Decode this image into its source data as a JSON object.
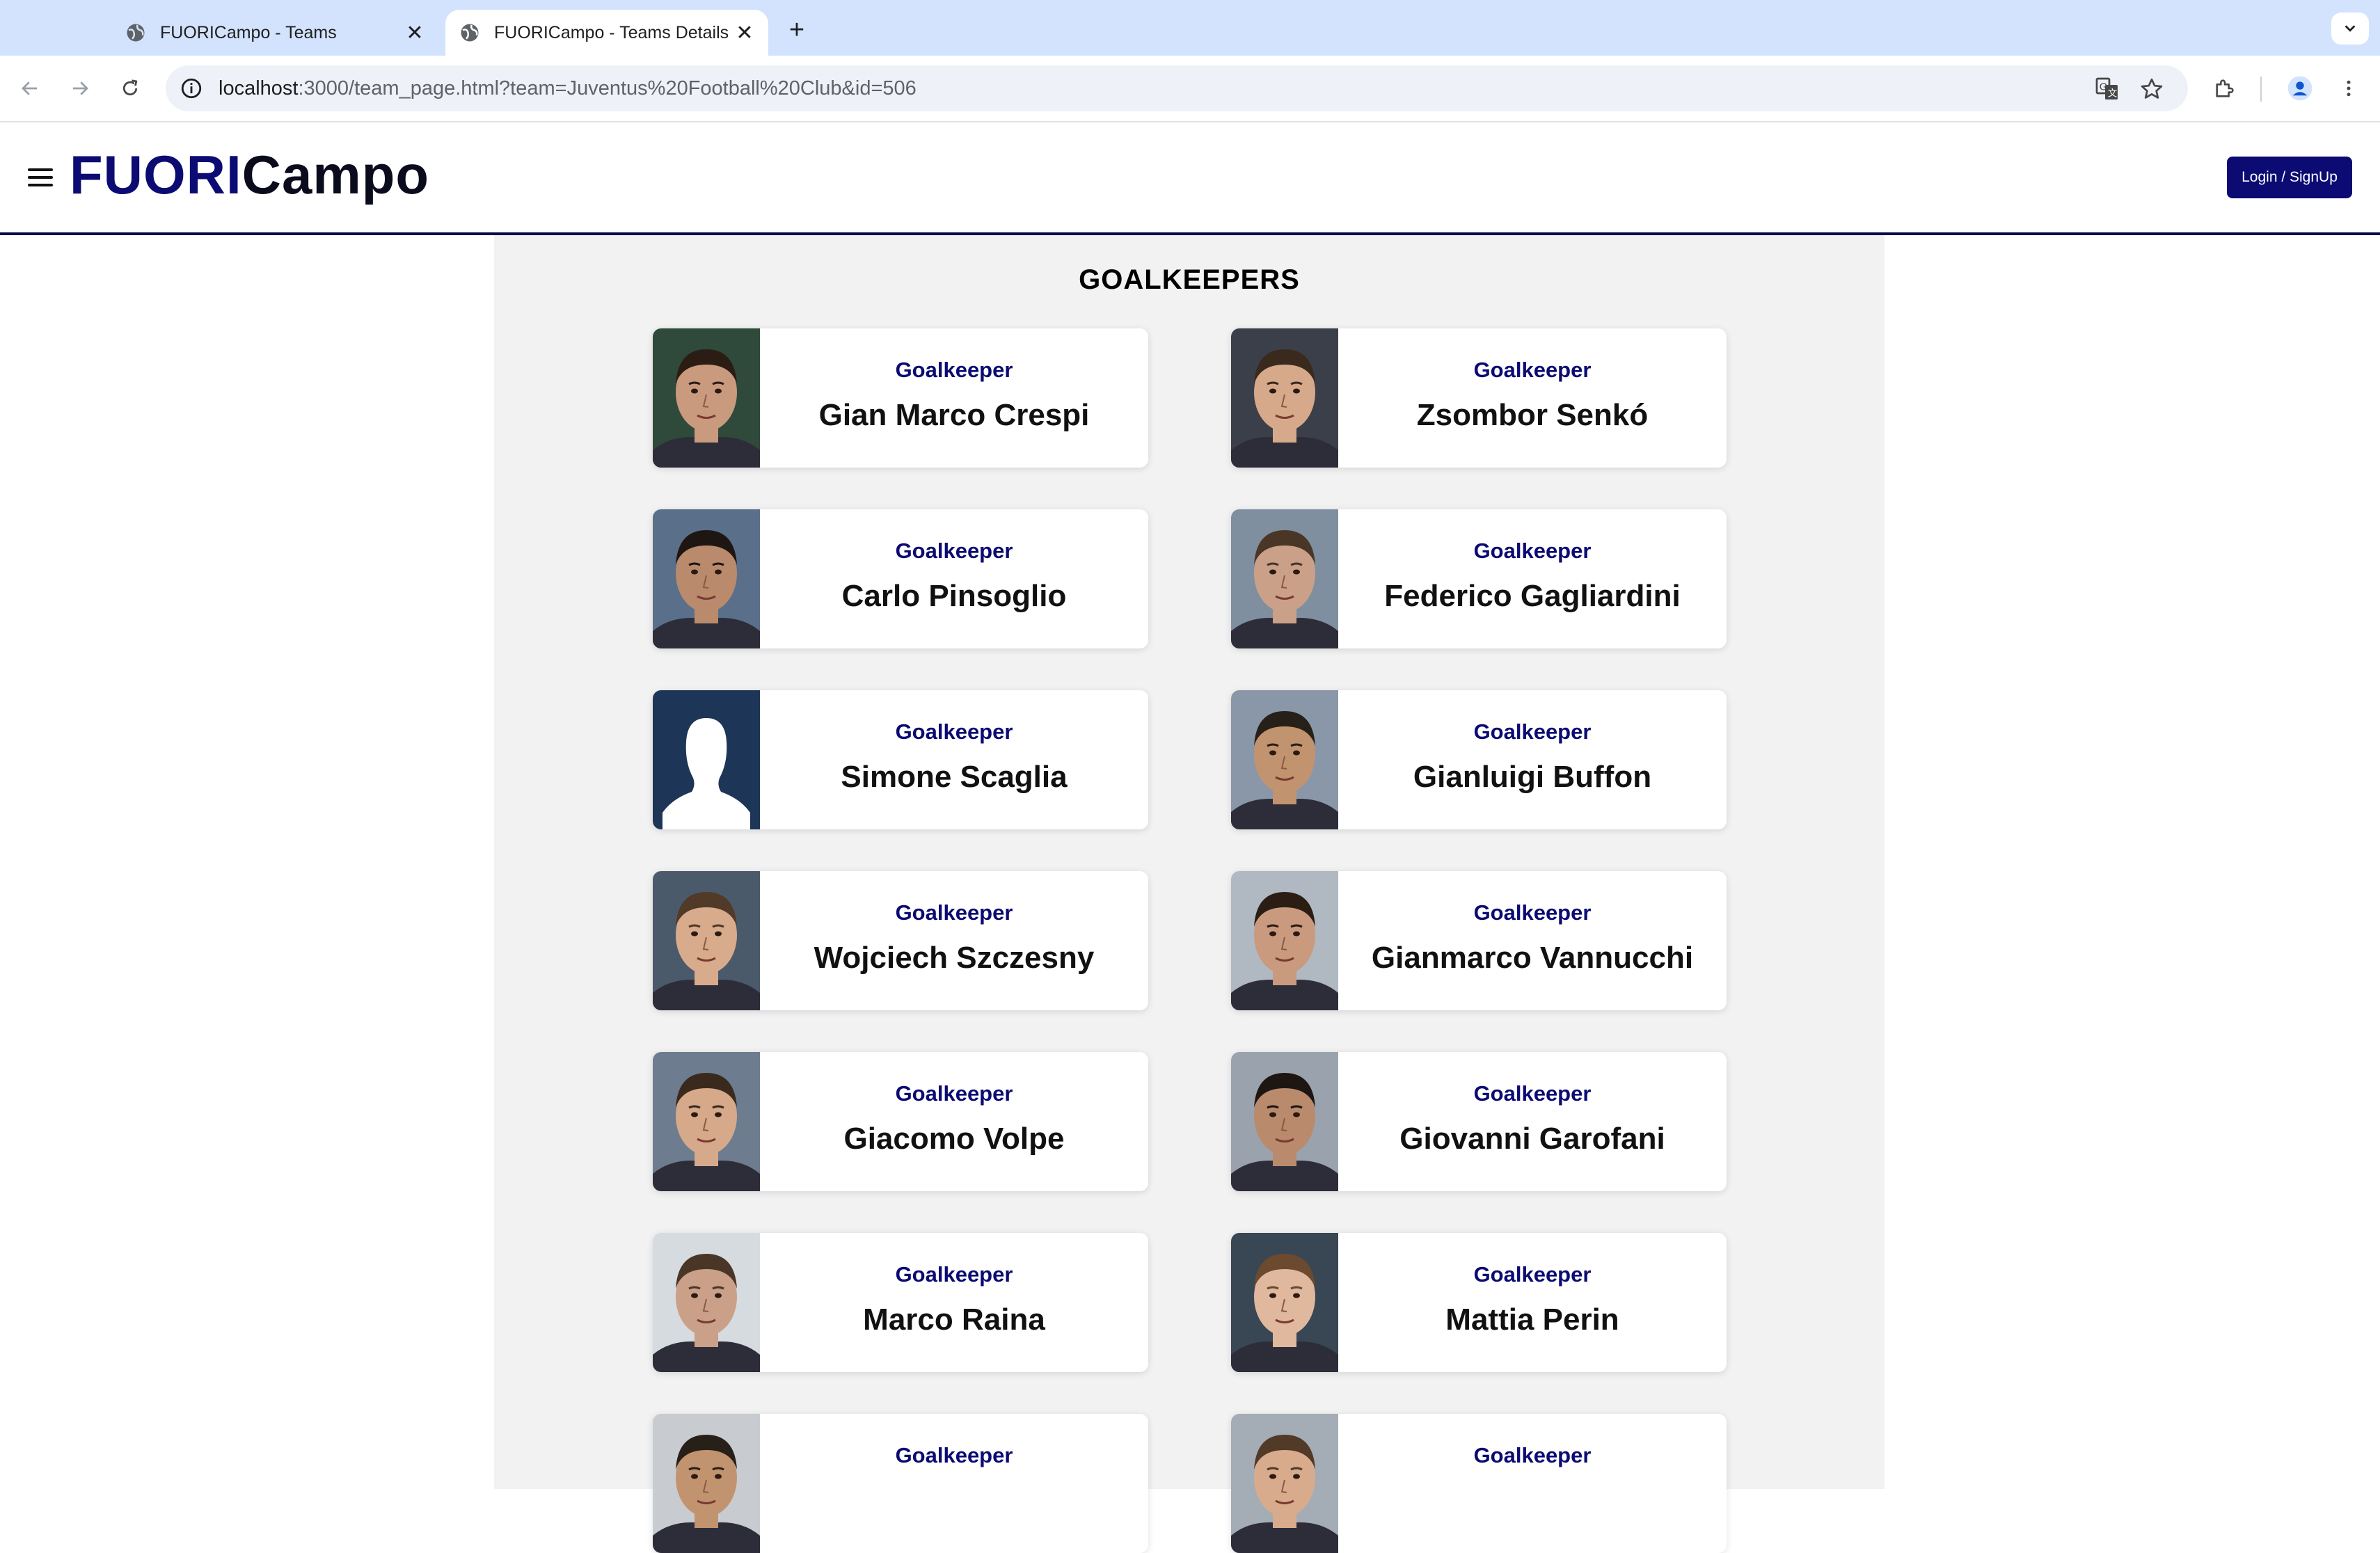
{
  "browser": {
    "tabs": [
      {
        "title": "FUORICampo - Teams",
        "active": false
      },
      {
        "title": "FUORICampo - Teams Details",
        "active": true
      }
    ],
    "url_host": "localhost",
    "url_path": ":3000/team_page.html?team=Juventus%20Football%20Club&id=506"
  },
  "header": {
    "logo_part1": "FUORI",
    "logo_part2": "Campo",
    "login_label": "Login / SignUp"
  },
  "section": {
    "title": "GOALKEEPERS"
  },
  "players": [
    {
      "role": "Goalkeeper",
      "name": "Gian Marco Crespi",
      "photo": "portrait"
    },
    {
      "role": "Goalkeeper",
      "name": "Zsombor Senkó",
      "photo": "portrait"
    },
    {
      "role": "Goalkeeper",
      "name": "Carlo Pinsoglio",
      "photo": "portrait"
    },
    {
      "role": "Goalkeeper",
      "name": "Federico Gagliardini",
      "photo": "portrait"
    },
    {
      "role": "Goalkeeper",
      "name": "Simone Scaglia",
      "photo": "placeholder-silhouette"
    },
    {
      "role": "Goalkeeper",
      "name": "Gianluigi Buffon",
      "photo": "portrait"
    },
    {
      "role": "Goalkeeper",
      "name": "Wojciech Szczesny",
      "photo": "portrait"
    },
    {
      "role": "Goalkeeper",
      "name": "Gianmarco Vannucchi",
      "photo": "portrait"
    },
    {
      "role": "Goalkeeper",
      "name": "Giacomo Volpe",
      "photo": "portrait"
    },
    {
      "role": "Goalkeeper",
      "name": "Giovanni Garofani",
      "photo": "portrait"
    },
    {
      "role": "Goalkeeper",
      "name": "Marco Raina",
      "photo": "portrait"
    },
    {
      "role": "Goalkeeper",
      "name": "Mattia Perin",
      "photo": "portrait"
    },
    {
      "role": "Goalkeeper",
      "name": "",
      "photo": "portrait"
    },
    {
      "role": "Goalkeeper",
      "name": "",
      "photo": "portrait"
    }
  ],
  "colors": {
    "brand_navy": "#0b0b73",
    "tab_strip": "#d3e3fd",
    "content_bg": "#f2f2f2"
  },
  "icons": [
    "globe-icon",
    "close-icon",
    "plus-icon",
    "chevron-down-icon",
    "back-icon",
    "forward-icon",
    "reload-icon",
    "info-icon",
    "translate-icon",
    "star-icon",
    "extensions-icon",
    "profile-icon",
    "more-vert-icon",
    "hamburger-icon",
    "silhouette-icon"
  ]
}
